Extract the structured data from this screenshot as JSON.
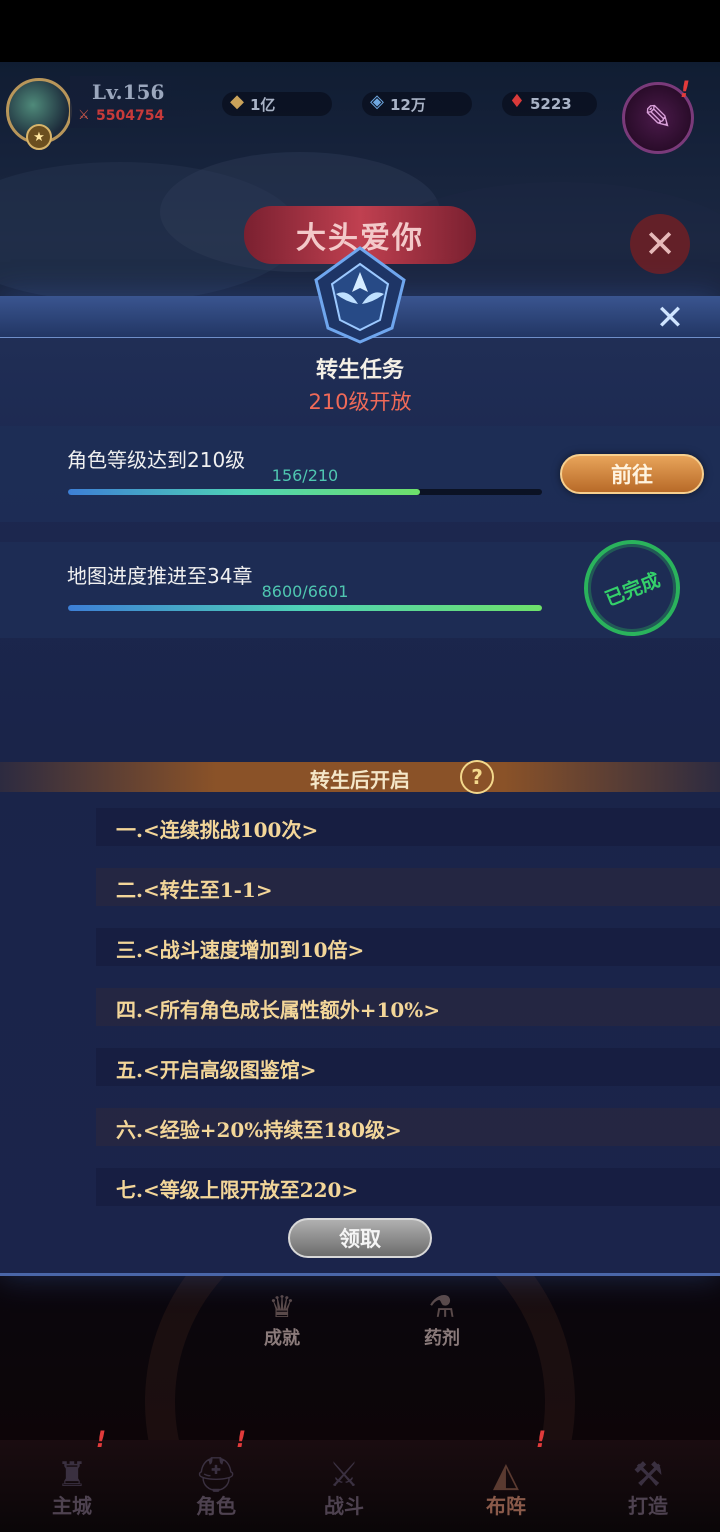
{
  "hud": {
    "level": "Lv.156",
    "power": "5504754",
    "currencies": [
      {
        "name": "gold",
        "value": "1亿",
        "icon": "gold-icon"
      },
      {
        "name": "gem",
        "value": "12万",
        "icon": "gem-icon"
      },
      {
        "name": "ruby",
        "value": "5223",
        "icon": "ruby-icon"
      }
    ],
    "quest_badge": "!"
  },
  "background": {
    "event_banner": "大头爱你",
    "mid_icons": [
      "成就",
      "药剂"
    ],
    "nav": [
      {
        "label": "主城",
        "icon": "castle-icon"
      },
      {
        "label": "角色",
        "icon": "helmet-icon"
      },
      {
        "label": "战斗",
        "icon": "swords-icon"
      },
      {
        "label": "布阵",
        "icon": "formation-icon"
      },
      {
        "label": "打造",
        "icon": "anvil-icon"
      }
    ]
  },
  "modal": {
    "title": "转生任务",
    "subtitle": "210级开放",
    "tasks": [
      {
        "label": "角色等级达到210级",
        "progress_text": "156/210",
        "progress_fraction": 0.743,
        "action": "前往"
      },
      {
        "label": "地图进度推进至34章",
        "progress_text": "8600/6601",
        "progress_fraction": 1.0,
        "status": "已完成"
      }
    ],
    "unlock_title": "转生后开启",
    "unlock_items": [
      "一.<连续挑战100次>",
      "二.<转生至1-1>",
      "三.<战斗速度增加到10倍>",
      "四.<所有角色成长属性额外+10%>",
      "五.<开启高级图鉴馆>",
      "六.<经验+20%持续至180级>",
      "七.<等级上限开放至220>"
    ],
    "claim_label": "领取"
  },
  "colors": {
    "accent_orange": "#d8893f",
    "progress_green": "#4fd3b6",
    "subtitle_red": "#f06a58",
    "stamp_green": "#2ab35c"
  }
}
